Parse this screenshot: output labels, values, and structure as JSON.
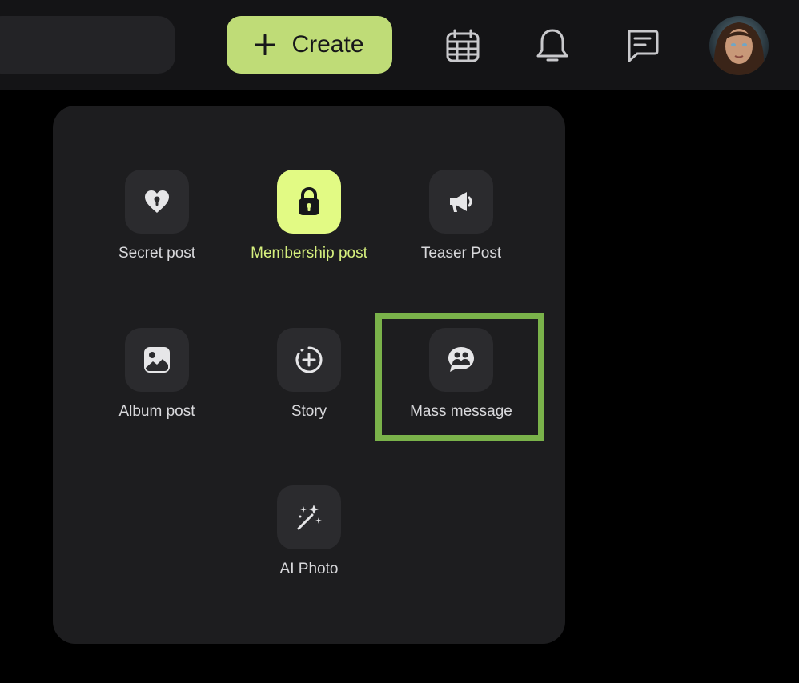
{
  "header": {
    "create_label": "Create",
    "icons": [
      "plus-icon",
      "calendar-icon",
      "bell-icon",
      "chat-icon"
    ],
    "accent_color": "#bfdc77"
  },
  "menu": {
    "items": [
      {
        "label": "Secret post",
        "icon": "heart-lock-icon"
      },
      {
        "label": "Membership post",
        "icon": "lock-icon",
        "active": true
      },
      {
        "label": "Teaser Post",
        "icon": "megaphone-icon"
      },
      {
        "label": "Album post",
        "icon": "image-icon"
      },
      {
        "label": "Story",
        "icon": "story-plus-icon"
      },
      {
        "label": "Mass message",
        "icon": "group-chat-icon",
        "highlighted": true
      },
      {
        "label": "AI Photo",
        "icon": "magic-wand-icon"
      }
    ],
    "active_color": "#e2fa84",
    "highlight_color": "#7ab24a"
  }
}
